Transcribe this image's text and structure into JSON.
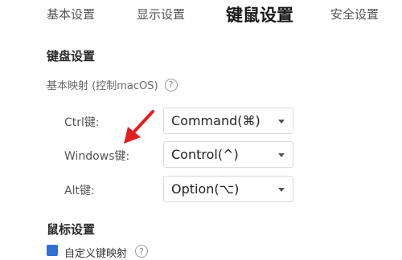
{
  "tabs": [
    {
      "label": "基本设置",
      "active": false
    },
    {
      "label": "显示设置",
      "active": false
    },
    {
      "label": "键鼠设置",
      "active": true
    },
    {
      "label": "安全设置",
      "active": false
    }
  ],
  "keyboard": {
    "heading": "键盘设置",
    "mapping_label": "基本映射 (控制macOS)",
    "help_icon": "?",
    "rows": [
      {
        "label": "Ctrl键:",
        "value": "Command(⌘)"
      },
      {
        "label": "Windows键:",
        "value": "Control(^)"
      },
      {
        "label": "Alt键:",
        "value": "Option(⌥)"
      }
    ]
  },
  "mouse": {
    "heading": "鼠标设置",
    "custom_mapping_label": "自定义键映射",
    "custom_mapping_checked": true,
    "help_icon": "?"
  },
  "colors": {
    "checkbox": "#2f6fd6",
    "annotation_arrow": "#e02020"
  },
  "icons": {
    "select_caret": "caret-down-icon",
    "help": "question-circle-icon",
    "annotation": "red-arrow-icon"
  }
}
